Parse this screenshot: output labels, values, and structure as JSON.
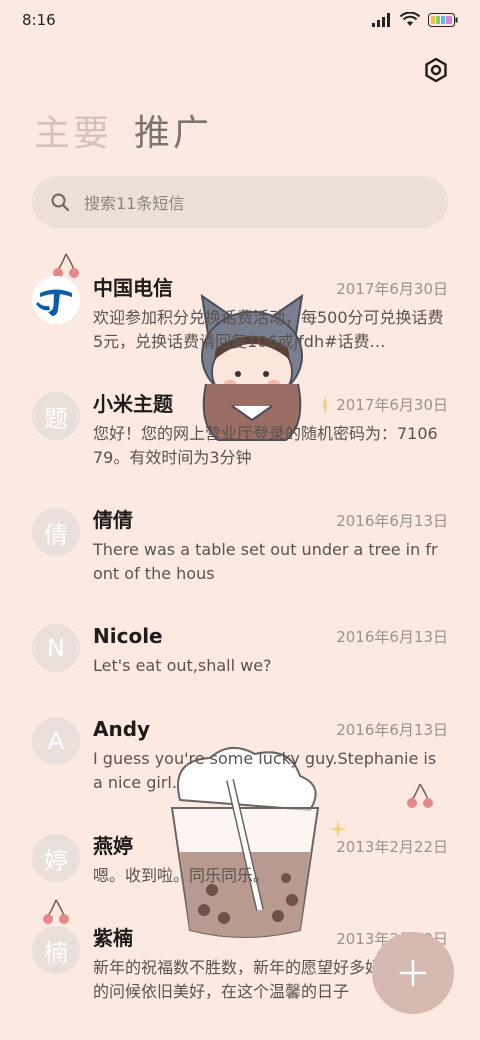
{
  "status_bar": {
    "time": "8:16"
  },
  "tabs": {
    "primary": "主要",
    "promotions": "推广"
  },
  "search": {
    "placeholder": "搜索11条短信"
  },
  "conversations": [
    {
      "avatar": "",
      "name": "中国电信",
      "date": "2017年6月30日",
      "message": "欢迎参加积分兑换话费活动，每500分可兑换话费5元，兑换话费请回复106或jfdh#话费…"
    },
    {
      "avatar": "题",
      "name": "小米主题",
      "date": "2017年6月30日",
      "message": "您好！您的网上营业厅登录的随机密码为：710679。有效时间为3分钟"
    },
    {
      "avatar": "倩",
      "name": "倩倩",
      "date": "2016年6月13日",
      "message": "There was a table set out under a tree in front of the hous"
    },
    {
      "avatar": "N",
      "name": "Nicole",
      "date": "2016年6月13日",
      "message": "Let's eat out,shall we?"
    },
    {
      "avatar": "A",
      "name": "Andy",
      "date": "2016年6月13日",
      "message": "I guess you're some lucky guy.Stephanie is a nice girl."
    },
    {
      "avatar": "婷",
      "name": "燕婷",
      "date": "2013年2月22日",
      "message": "嗯。收到啦。同乐同乐。"
    },
    {
      "avatar": "楠",
      "name": "紫楠",
      "date": "2013年2月22日",
      "message": "新年的祝福数不胜数，新年的愿望好多好多，新年的问候依旧美好，在这个温馨的日子"
    }
  ],
  "colors": {
    "background": "#fbe9e2",
    "accent": "#d6b9b1",
    "telecom_blue": "#0b5cab"
  }
}
